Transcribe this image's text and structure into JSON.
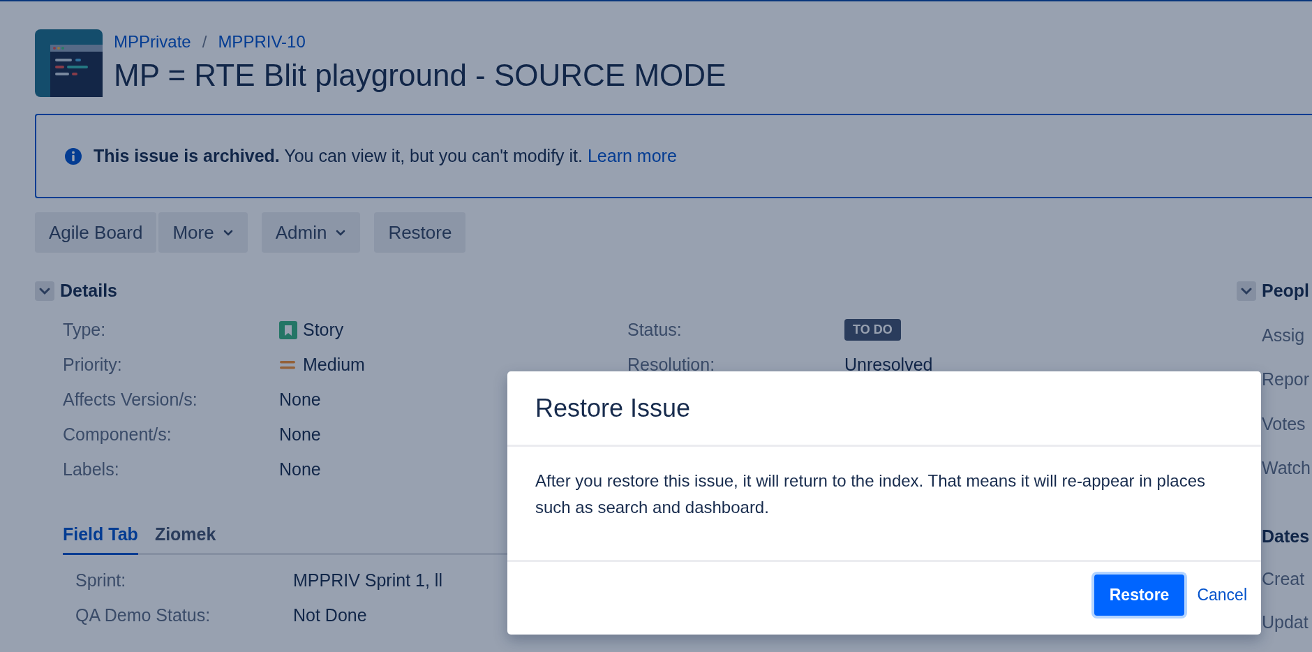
{
  "project": {
    "breadcrumbs": [
      "MPPrivate",
      "MPPRIV-10"
    ],
    "separator": "/",
    "title": "MP = RTE Blit playground - SOURCE MODE"
  },
  "banner": {
    "text": "**This issue is archived.** You can view it, but you can't modify it.",
    "link": "Learn more"
  },
  "toolbar": [
    [
      {
        "label": "Agile Board",
        "dropdown": false
      },
      {
        "label": "More",
        "dropdown": true
      }
    ],
    [
      {
        "label": "Admin",
        "dropdown": true
      }
    ],
    [
      {
        "label": "Restore",
        "dropdown": false
      }
    ]
  ],
  "details": {
    "title": "Details",
    "expanded": true,
    "fields": [
      {
        "label": "Type:",
        "value": "Story",
        "kind": "story"
      },
      {
        "label": "Priority:",
        "value": "Medium",
        "kind": "priority"
      },
      {
        "label": "Affects Version/s:",
        "value": "None",
        "kind": "text"
      },
      {
        "label": "Component/s:",
        "value": "None",
        "kind": "text"
      },
      {
        "label": "Labels:",
        "value": "None",
        "kind": "text"
      }
    ],
    "status_fields": [
      {
        "label": "Status:",
        "value": "TO DO",
        "kind": "lozenge"
      },
      {
        "label": "Resolution:",
        "value": "Unresolved",
        "kind": "text"
      }
    ]
  },
  "tabs": [
    {
      "label": "Field Tab",
      "selected": true
    },
    {
      "label": "Ziomek",
      "selected": false
    }
  ],
  "tab_fields": [
    {
      "label": "Sprint:",
      "value": "MPPRIV Sprint 1, ll"
    },
    {
      "label": "QA Demo Status:",
      "value": "Not Done"
    }
  ],
  "people": {
    "title": "Peopl",
    "expanded": true,
    "labels": [
      "Assig",
      "Repor",
      "Votes",
      "Watch"
    ]
  },
  "dates": {
    "title": "Dates",
    "labels": [
      "Creat",
      "Updat"
    ]
  },
  "dialog": {
    "title": "Restore Issue",
    "message": "After you restore this issue, it will return to the index. That means it will re-appear in places such as search and dashboard.",
    "buttons": [
      {
        "label": "Restore",
        "kind": "primary"
      },
      {
        "label": "Cancel",
        "kind": "link"
      }
    ]
  }
}
